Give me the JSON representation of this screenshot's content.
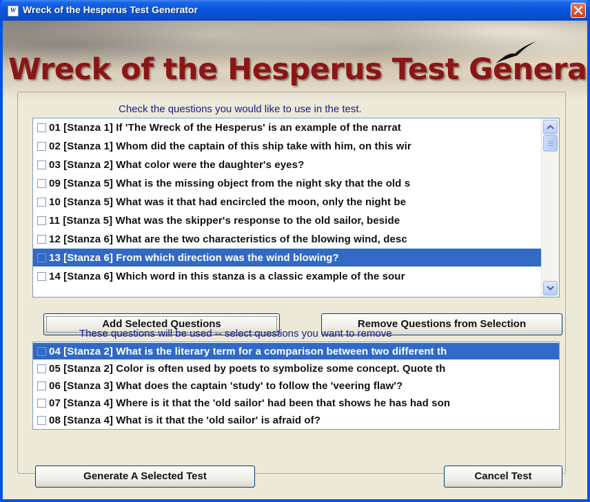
{
  "window": {
    "title": "Wreck of the Hesperus Test Generator",
    "icon_label": "W"
  },
  "banner": {
    "title": "Wreck of the Hesperus Test Generator"
  },
  "available": {
    "caption": "Check the questions you would like to use in the test.",
    "items": [
      {
        "text": "01 [Stanza 1]  If 'The Wreck of the Hesperus' is an example of the narrat",
        "selected": false
      },
      {
        "text": "02 [Stanza 1]  Whom did the captain of this ship take with him, on this wir",
        "selected": false
      },
      {
        "text": "03 [Stanza 2]  What color were the daughter's eyes?",
        "selected": false
      },
      {
        "text": "09 [Stanza 5]  What is the missing object from the night sky that the old s",
        "selected": false
      },
      {
        "text": "10 [Stanza 5]  What was it that had encircled the moon, only the night be",
        "selected": false
      },
      {
        "text": "11 [Stanza 5]  What was the skipper's response to the old sailor, beside",
        "selected": false
      },
      {
        "text": "12 [Stanza 6]  What are the two characteristics of the blowing wind, desc",
        "selected": false
      },
      {
        "text": "13 [Stanza 6]  From which direction was the wind blowing?",
        "selected": true
      },
      {
        "text": "14 [Stanza 6]  Which word in this stanza is a classic example of the sour",
        "selected": false
      }
    ]
  },
  "buttons": {
    "add": "Add Selected Questions",
    "remove": "Remove Questions from Selection",
    "generate": "Generate A Selected Test",
    "cancel": "Cancel Test"
  },
  "selected_list": {
    "caption": "These questions will be used --  select questions you want to remove",
    "items": [
      {
        "text": "04 [Stanza 2]  What is the literary term for a comparison between two different th",
        "selected": true
      },
      {
        "text": "05 [Stanza 2]  Color is often used by poets to symbolize some concept.  Quote th",
        "selected": false
      },
      {
        "text": "06 [Stanza 3]  What does the captain 'study' to follow the 'veering flaw'?",
        "selected": false
      },
      {
        "text": "07 [Stanza 4]  Where is it that the 'old sailor' had been that shows he has had son",
        "selected": false
      },
      {
        "text": "08 [Stanza 4]  What is it that the 'old sailor' is afraid of?",
        "selected": false
      }
    ]
  },
  "colors": {
    "title_bar": "#0a55dc",
    "selection": "#316ac5",
    "banner_text": "#8a1616",
    "caption_text": "#1a1a8c"
  }
}
